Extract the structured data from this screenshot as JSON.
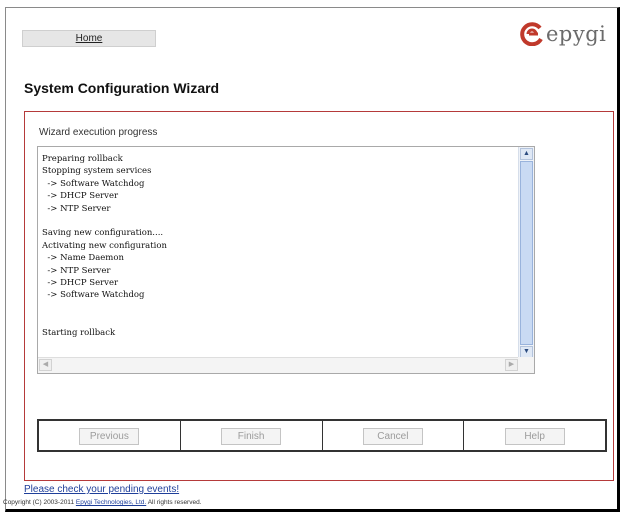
{
  "nav": {
    "home_label": "Home"
  },
  "brand": {
    "logo_text": "epygi",
    "accent_color": "#c0392b"
  },
  "page": {
    "title": "System Configuration Wizard"
  },
  "wizard": {
    "section_label": "Wizard execution progress",
    "log_lines": [
      "Preparing rollback",
      "Stopping system services",
      "  -> Software Watchdog",
      "  -> DHCP Server",
      "  -> NTP Server",
      "",
      "Saving new configuration....",
      "Activating new configuration",
      "  -> Name Daemon",
      "  -> NTP Server",
      "  -> DHCP Server",
      "  -> Software Watchdog",
      "",
      "",
      "Starting rollback"
    ]
  },
  "buttons": {
    "previous": "Previous",
    "finish": "Finish",
    "cancel": "Cancel",
    "help": "Help"
  },
  "footer": {
    "pending_events": "Please check your pending events!",
    "copyright_prefix": "Copyright (C) 2003-2011",
    "company_link": "Epygi Technologies, Ltd.",
    "copyright_suffix": "All rights reserved."
  }
}
